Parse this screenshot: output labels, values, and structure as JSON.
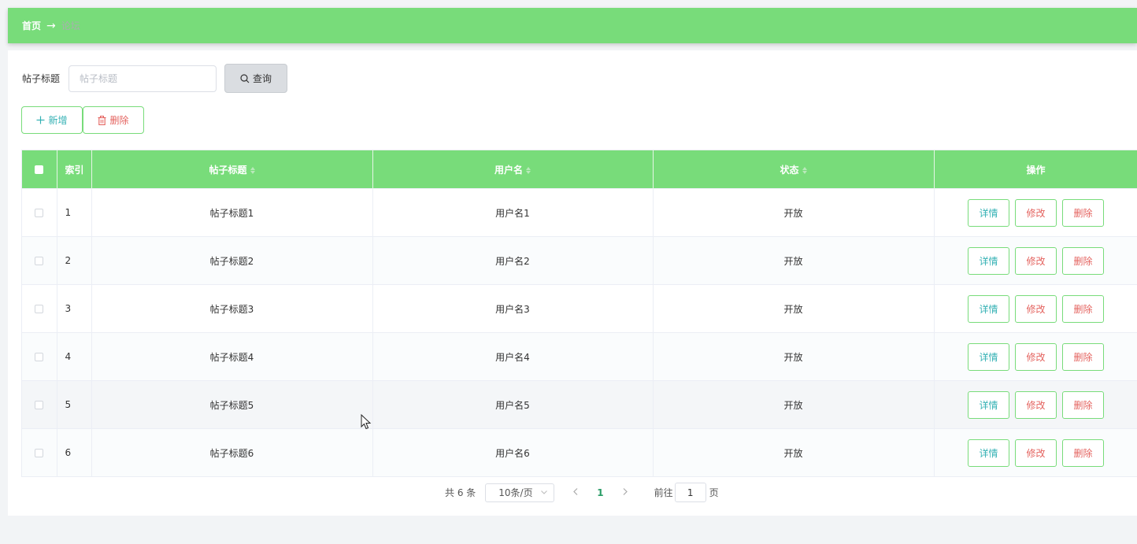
{
  "breadcrumb": {
    "home": "首页",
    "separator": "→",
    "current": "论坛"
  },
  "search": {
    "label": "帖子标题",
    "placeholder": "帖子标题",
    "query_label": "查询"
  },
  "actions": {
    "add_label": "新增",
    "delete_label": "删除"
  },
  "table": {
    "headers": {
      "index": "索引",
      "title": "帖子标题",
      "username": "用户名",
      "status": "状态",
      "ops": "操作"
    },
    "rows": [
      {
        "index": "1",
        "title": "帖子标题1",
        "username": "用户名1",
        "status": "开放"
      },
      {
        "index": "2",
        "title": "帖子标题2",
        "username": "用户名2",
        "status": "开放"
      },
      {
        "index": "3",
        "title": "帖子标题3",
        "username": "用户名3",
        "status": "开放"
      },
      {
        "index": "4",
        "title": "帖子标题4",
        "username": "用户名4",
        "status": "开放"
      },
      {
        "index": "5",
        "title": "帖子标题5",
        "username": "用户名5",
        "status": "开放"
      },
      {
        "index": "6",
        "title": "帖子标题6",
        "username": "用户名6",
        "status": "开放"
      }
    ],
    "row_actions": {
      "detail": "详情",
      "edit": "修改",
      "delete": "删除"
    }
  },
  "pagination": {
    "total_text": "共 6 条",
    "page_size": "10条/页",
    "current_page": "1",
    "goto_label": "前往",
    "goto_value": "1",
    "page_suffix": "页"
  },
  "icons": {
    "search": "search-icon",
    "add": "plus-icon",
    "delete": "trash-icon",
    "prev": "chevron-left-icon",
    "next": "chevron-right-icon",
    "dropdown": "chevron-down-icon",
    "sort": "sort-caret-icon",
    "cursor": "mouse-pointer-icon"
  },
  "colors": {
    "header_green": "#78dc7a",
    "teal_text": "#34b1b4",
    "red_text": "#e4635f",
    "active_page": "#2a9d67"
  }
}
